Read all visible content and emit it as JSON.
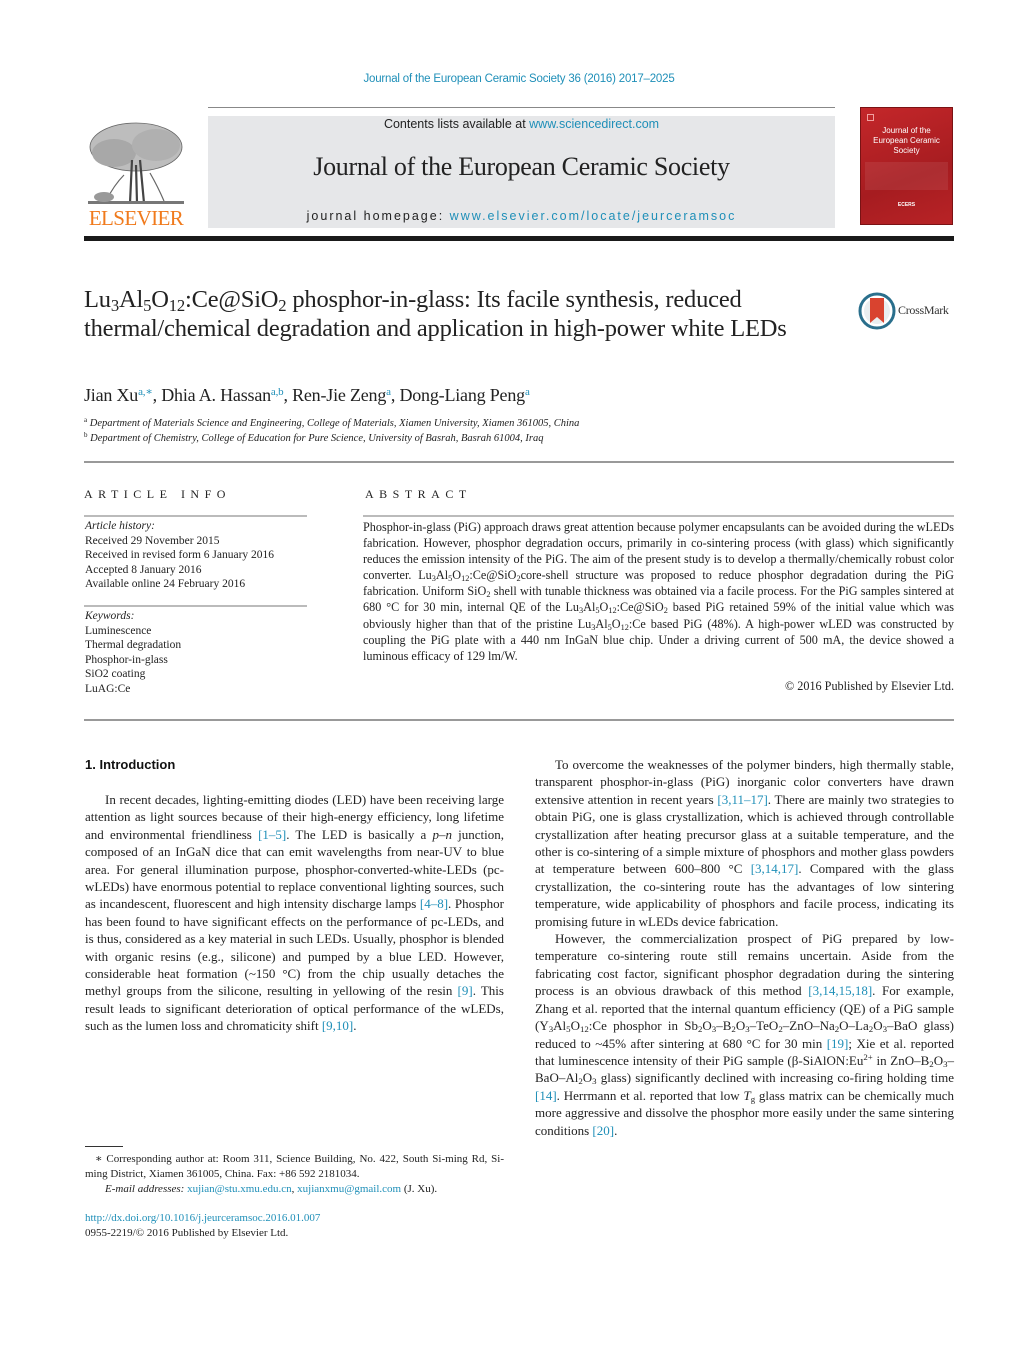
{
  "header": {
    "citation": "Journal of the European Ceramic Society 36 (2016) 2017–2025",
    "publisher_logo_text": "ELSEVIER",
    "contents_prefix": "Contents lists available at ",
    "contents_link": "www.sciencedirect.com",
    "journal_name": "Journal of the European Ceramic Society",
    "homepage_prefix": "journal homepage: ",
    "homepage_link": "www.elsevier.com/locate/jeurceramsoc",
    "cover": {
      "title_line1": "Journal of the",
      "title_line2": "European Ceramic Society",
      "society": "ECERS"
    },
    "colors": {
      "link": "#1f8fb8",
      "elsevier_orange": "#f07a1c",
      "cover_red": "#b82326",
      "masthead_gray": "#e6e7e9"
    }
  },
  "article": {
    "title": {
      "p1": "Lu",
      "s1": "3",
      "p2": "Al",
      "s2": "5",
      "p3": "O",
      "s3": "12",
      "p4": ":Ce@SiO",
      "s4": "2",
      "p5": " phosphor-in-glass: Its facile synthesis, reduced thermal/chemical degradation and application in high-power white LEDs"
    },
    "crossmark_label": "CrossMark",
    "authors": [
      {
        "name": "Jian Xu",
        "marks": "a,∗"
      },
      {
        "name": "Dhia A. Hassan",
        "marks": "a,b"
      },
      {
        "name": "Ren-Jie Zeng",
        "marks": "a"
      },
      {
        "name": "Dong-Liang Peng",
        "marks": "a"
      }
    ],
    "affiliations": [
      {
        "mark": "a",
        "text": "Department of Materials Science and Engineering, College of Materials, Xiamen University, Xiamen 361005, China"
      },
      {
        "mark": "b",
        "text": "Department of Chemistry, College of Education for Pure Science, University of Basrah, Basrah 61004, Iraq"
      }
    ]
  },
  "article_info": {
    "heading": "ARTICLE INFO",
    "history_label": "Article history:",
    "history": [
      "Received 29 November 2015",
      "Received in revised form 6 January 2016",
      "Accepted 8 January 2016",
      "Available online 24 February 2016"
    ],
    "keywords_label": "Keywords:",
    "keywords": [
      "Luminescence",
      "Thermal degradation",
      "Phosphor-in-glass",
      "SiO2 coating",
      "LuAG:Ce"
    ]
  },
  "abstract": {
    "heading": "ABSTRACT",
    "t1": "Phosphor-in-glass (PiG) approach draws great attention because polymer encapsulants can be avoided during the wLEDs fabrication. However, phosphor degradation occurs, primarily in co-sintering process (with glass) which significantly reduces the emission intensity of the PiG. The aim of the present study is to develop a thermally/chemically robust color converter. Lu",
    "t2": "Al",
    "t3": "O",
    "t4": ":Ce@SiO",
    "t5": "core-shell structure was proposed to reduce phosphor degradation during the PiG fabrication. Uniform SiO",
    "t6": " shell with tunable thickness was obtained via a facile process. For the PiG samples sintered at 680 °C for 30 min, internal QE of the Lu",
    "t7": " based PiG retained 59% of the initial value which was obviously higher than that of the pristine Lu",
    "t8": ":Ce based PiG (48%). A high-power wLED was constructed by coupling the PiG plate with a 440 nm InGaN blue chip. Under a driving current of 500 mA, the device showed a luminous efficacy of 129 lm/W.",
    "copyright": "© 2016 Published by Elsevier Ltd."
  },
  "introduction": {
    "heading": "1.  Introduction",
    "left": {
      "a1": "In recent decades, lighting-emitting diodes (LED) have been receiving large attention as light sources because of their high-energy efficiency, long lifetime and environmental friendliness ",
      "r1": "[1–5]",
      "a2": ". The LED is basically a ",
      "pn": "p–n",
      "a3": " junction, composed of an InGaN dice that can emit wavelengths from near-UV to blue area. For general illumination purpose, phosphor-converted-white-LEDs (pc-wLEDs) have enormous potential to replace conventional lighting sources, such as incandescent, fluorescent and high intensity discharge lamps ",
      "r2": "[4–8]",
      "a4": ". Phosphor has been found to have significant effects on the performance of pc-LEDs, and is thus, considered as a key material in such LEDs. Usually, phosphor is blended with organic resins (e.g., silicone) and pumped by a blue LED. However, considerable heat formation (~150 °C) from the chip usually detaches the methyl groups from the silicone, resulting in yellowing of the resin ",
      "r3": "[9]",
      "a5": ". This result leads to significant deterioration of optical performance of the wLEDs, such as the lumen loss and chromaticity shift ",
      "r4": "[9,10]",
      "a6": "."
    },
    "right": {
      "b1": "To overcome the weaknesses of the polymer binders, high thermally stable, transparent phosphor-in-glass (PiG) inorganic color converters have drawn extensive attention in recent years ",
      "r1": "[3,11–17]",
      "b2": ". There are mainly two strategies to obtain PiG, one is glass crystallization, which is achieved through controllable crystallization after heating precursor glass at a suitable temperature, and the other is co-sintering of a simple mixture of phosphors and mother glass powders at temperature between 600–800 °C ",
      "r2": "[3,14,17]",
      "b3": ". Compared with the glass crystallization, the co-sintering route has the advantages of low sintering temperature, wide applicability of phosphors and facile process, indicating its promising future in wLEDs device fabrication.",
      "c1": "However, the commercialization prospect of PiG prepared by low-temperature co-sintering route still remains uncertain. Aside from the fabricating cost factor, significant phosphor degradation during the sintering process is an obvious drawback of this method ",
      "r3": "[3,14,15,18]",
      "c2": ". For example, Zhang et al. reported that the internal quantum efficiency (QE) of a PiG sample (Y",
      "c3": ":Ce phosphor in Sb",
      "c4": "–TeO",
      "c5": "–ZnO–Na",
      "c6": "O–La",
      "c7": "–BaO glass) reduced to ~45% after sintering at 680 °C for 30 min ",
      "r4": "[19]",
      "c8": "; Xie et al. reported that luminescence intensity of their PiG sample (β-SiAlON:Eu",
      "c8sup": "2+",
      "c9": " in ZnO–B",
      "c10": "–BaO–Al",
      "c11": " glass) significantly declined with increasing co-firing holding time ",
      "r5": "[14]",
      "c12": ". Herrmann et al. reported that low ",
      "tg": "T",
      "tgsub": "g",
      "c13": " glass matrix can be chemically much more aggressive and dissolve the phosphor more easily under the same sintering conditions ",
      "r6": "[20]",
      "c14": "."
    }
  },
  "footnotes": {
    "corresponding": "∗ Corresponding author at: Room 311, Science Building, No. 422, South Si-ming Rd, Si-ming District, Xiamen 361005, China. Fax: +86 592 2181034.",
    "email_label": "E-mail addresses: ",
    "email1": "xujian@stu.xmu.edu.cn",
    "email2": "xujianxmu@gmail.com",
    "email_suffix": " (J. Xu).",
    "doi": "http://dx.doi.org/10.1016/j.jeurceramsoc.2016.01.007",
    "issn": "0955-2219/© 2016 Published by Elsevier Ltd."
  }
}
